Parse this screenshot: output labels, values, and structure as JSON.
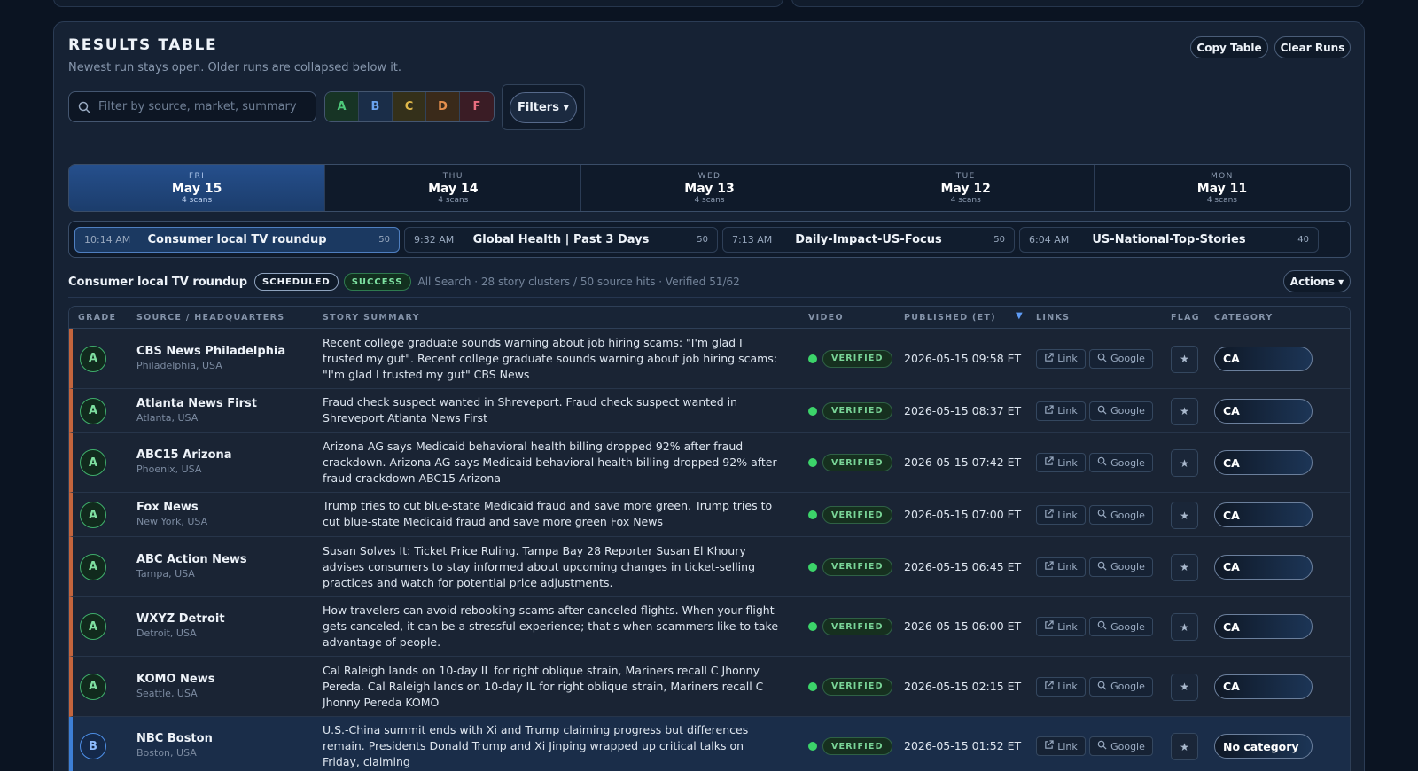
{
  "panel": {
    "title": "RESULTS TABLE",
    "subtitle": "Newest run stays open. Older runs are collapsed below it.",
    "copy_label": "Copy Table",
    "clear_label": "Clear Runs"
  },
  "search": {
    "placeholder": "Filter by source, market, summary",
    "value": ""
  },
  "grade_filters": [
    {
      "label": "A",
      "color": "#4ec97a",
      "bg": "#173425"
    },
    {
      "label": "B",
      "color": "#6aa3ef",
      "bg": "#1a2d48"
    },
    {
      "label": "C",
      "color": "#e0b84a",
      "bg": "#34301a"
    },
    {
      "label": "D",
      "color": "#e7904d",
      "bg": "#3a2a1a"
    },
    {
      "label": "F",
      "color": "#ea6e80",
      "bg": "#3a1c25"
    }
  ],
  "filters_label": "Filters ▾",
  "days": [
    {
      "dow": "FRI",
      "date": "May 15",
      "scans": "4 scans",
      "active": true
    },
    {
      "dow": "THU",
      "date": "May 14",
      "scans": "4 scans",
      "active": false
    },
    {
      "dow": "WED",
      "date": "May 13",
      "scans": "4 scans",
      "active": false
    },
    {
      "dow": "TUE",
      "date": "May 12",
      "scans": "4 scans",
      "active": false
    },
    {
      "dow": "MON",
      "date": "May 11",
      "scans": "4 scans",
      "active": false
    }
  ],
  "runs": [
    {
      "time": "10:14 AM",
      "name": "Consumer local TV roundup",
      "count": "50",
      "active": true
    },
    {
      "time": "9:32 AM",
      "name": "Global Health | Past 3 Days",
      "count": "50",
      "active": false
    },
    {
      "time": "7:13 AM",
      "name": "Daily-Impact-US-Focus",
      "count": "50",
      "active": false
    },
    {
      "time": "6:04 AM",
      "name": "US-National-Top-Stories",
      "count": "40",
      "active": false
    }
  ],
  "meta": {
    "title": "Consumer local TV roundup",
    "scheduled": "SCHEDULED",
    "success": "SUCCESS",
    "info": "All Search  ·  28 story clusters / 50 source hits  ·  Verified 51/62",
    "actions_label": "Actions ▾"
  },
  "columns": {
    "grade": "GRADE",
    "source": "SOURCE / HEADQUARTERS",
    "summary": "STORY SUMMARY",
    "video": "VIDEO",
    "published": "PUBLISHED (ET)",
    "links": "LINKS",
    "flag": "FLAG",
    "category": "CATEGORY"
  },
  "link_label": "Link",
  "google_label": "Google",
  "rows": [
    {
      "grade": "A",
      "source": "CBS News Philadelphia",
      "hq": "Philadelphia, USA",
      "summary": "Recent college graduate sounds warning about job hiring scams: \"I'm glad I trusted my gut\". Recent college graduate sounds warning about job hiring scams: \"I'm glad I trusted my gut\" CBS News",
      "lines": 3,
      "video": "VERIFIED",
      "published": "2026-05-15 09:58 ET",
      "category": "CA"
    },
    {
      "grade": "A",
      "source": "Atlanta News First",
      "hq": "Atlanta, USA",
      "summary": "Fraud check suspect wanted in Shreveport. Fraud check suspect wanted in Shreveport Atlanta News First",
      "lines": 2,
      "video": "VERIFIED",
      "published": "2026-05-15 08:37 ET",
      "category": "CA"
    },
    {
      "grade": "A",
      "source": "ABC15 Arizona",
      "hq": "Phoenix, USA",
      "summary": "Arizona AG says Medicaid behavioral health billing dropped 92% after fraud crackdown. Arizona AG says Medicaid behavioral health billing dropped 92% after fraud crackdown ABC15 Arizona",
      "lines": 3,
      "video": "VERIFIED",
      "published": "2026-05-15 07:42 ET",
      "category": "CA"
    },
    {
      "grade": "A",
      "source": "Fox News",
      "hq": "New York, USA",
      "summary": "Trump tries to cut blue-state Medicaid fraud and save more green. Trump tries to cut blue-state Medicaid fraud and save more green Fox News",
      "lines": 2,
      "video": "VERIFIED",
      "published": "2026-05-15 07:00 ET",
      "category": "CA"
    },
    {
      "grade": "A",
      "source": "ABC Action News",
      "hq": "Tampa, USA",
      "summary": "Susan Solves It: Ticket Price Ruling. Tampa Bay 28 Reporter Susan El Khoury advises consumers to stay informed about upcoming changes in ticket-selling practices and watch for potential price adjustments.",
      "lines": 3,
      "video": "VERIFIED",
      "published": "2026-05-15 06:45 ET",
      "category": "CA"
    },
    {
      "grade": "A",
      "source": "WXYZ Detroit",
      "hq": "Detroit, USA",
      "summary": "How travelers can avoid rebooking scams after canceled flights. When your flight gets canceled, it can be a stressful experience; that's when scammers like to take advantage of people.",
      "lines": 3,
      "video": "VERIFIED",
      "published": "2026-05-15 06:00 ET",
      "category": "CA"
    },
    {
      "grade": "A",
      "source": "KOMO News",
      "hq": "Seattle, USA",
      "summary": "Cal Raleigh lands on 10-day IL for right oblique strain, Mariners recall C Jhonny Pereda. Cal Raleigh lands on 10-day IL for right oblique strain, Mariners recall C Jhonny Pereda KOMO",
      "lines": 3,
      "video": "VERIFIED",
      "published": "2026-05-15 02:15 ET",
      "category": "CA"
    },
    {
      "grade": "B",
      "source": "NBC Boston",
      "hq": "Boston, USA",
      "summary": "U.S.-China summit ends with Xi and Trump claiming progress but differences remain. Presidents Donald Trump and Xi Jinping wrapped up critical talks on Friday, claiming",
      "lines": 3,
      "video": "VERIFIED",
      "published": "2026-05-15 01:52 ET",
      "category": "No category"
    }
  ]
}
